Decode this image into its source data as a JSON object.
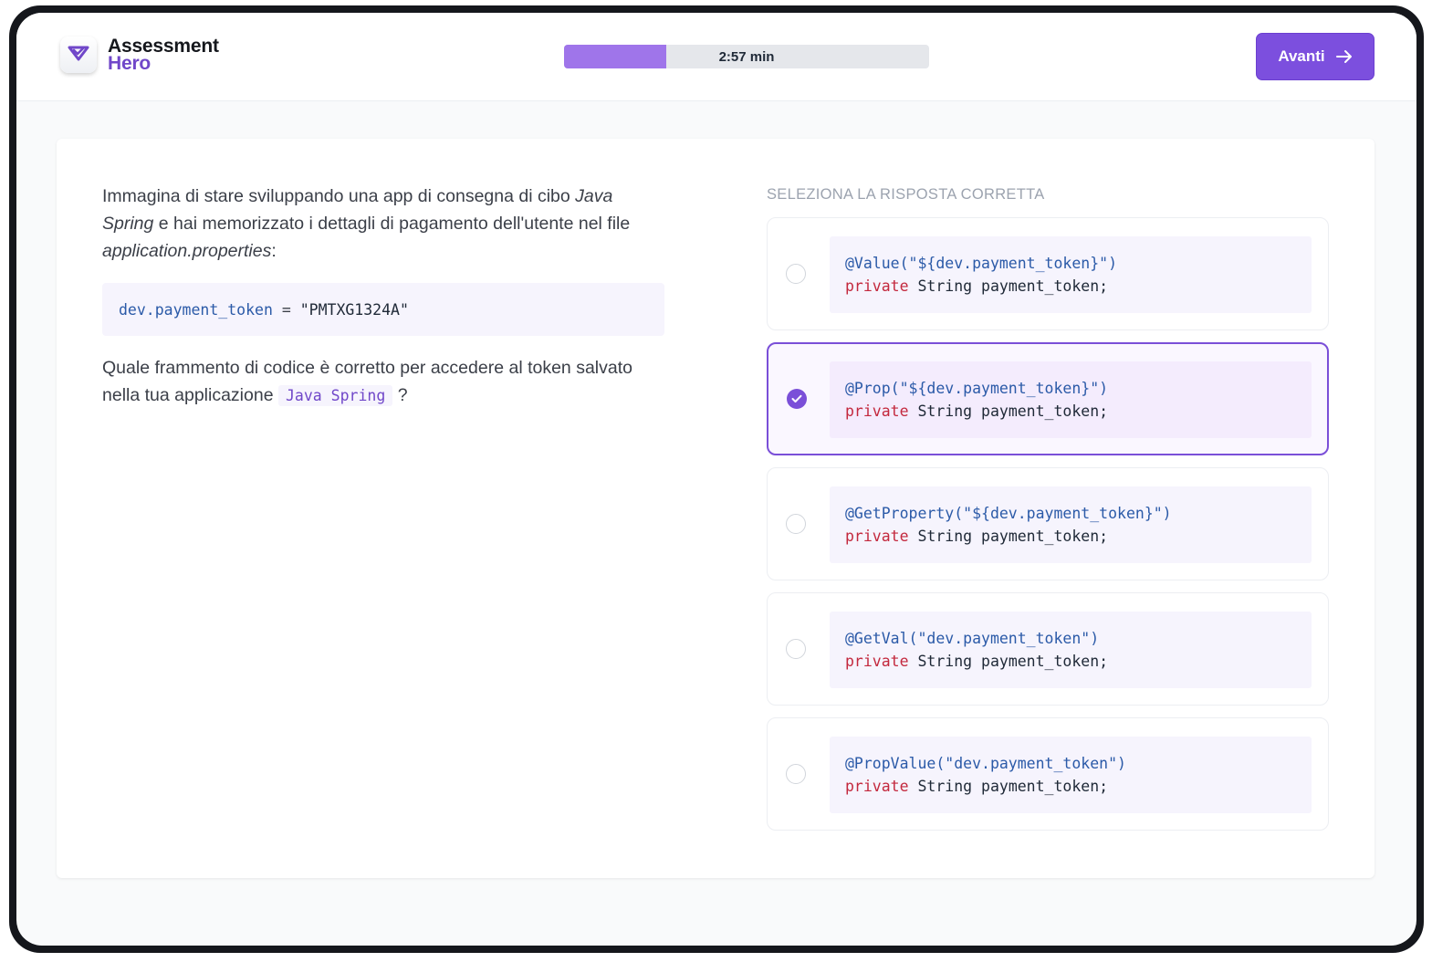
{
  "header": {
    "logo_line1": "Assessment",
    "logo_line2": "Hero",
    "timer": "2:57 min",
    "progress_fraction": 0.28,
    "next_label": "Avanti"
  },
  "question": {
    "intro_part1": "Immagina di stare sviluppando una app di consegna di cibo ",
    "intro_italic1": "Java Spring",
    "intro_part2": " e hai memorizzato i dettagli di pagamento dell'utente nel file ",
    "intro_italic2": "application.properties",
    "intro_part3": ":",
    "code_key": "dev.payment_token",
    "code_eq": " = ",
    "code_value": "\"PMTXG1324A\"",
    "prompt": "Quale frammento di codice è corretto per accedere al token salvato nella tua applicazione",
    "inline_code": "Java Spring",
    "prompt_end": "?"
  },
  "answers": {
    "title": "SELEZIONA LA RISPOSTA CORRETTA",
    "selected_index": 1,
    "options": [
      {
        "annotation": "@Value(\"${dev.payment_token}\")",
        "keyword": "private",
        "rest": " String payment_token;"
      },
      {
        "annotation": "@Prop(\"${dev.payment_token}\")",
        "keyword": "private",
        "rest": " String payment_token;"
      },
      {
        "annotation": "@GetProperty(\"${dev.payment_token}\")",
        "keyword": "private",
        "rest": " String payment_token;"
      },
      {
        "annotation": "@GetVal(\"dev.payment_token\")",
        "keyword": "private",
        "rest": " String payment_token;"
      },
      {
        "annotation": "@PropValue(\"dev.payment_token\")",
        "keyword": "private",
        "rest": " String payment_token;"
      }
    ]
  },
  "colors": {
    "accent": "#7c4fde",
    "progress_fill": "#9f75ea",
    "annotation": "#2b5aa8",
    "keyword": "#c3283d"
  },
  "icons": {
    "logo": "check-chevron-icon",
    "next": "arrow-right-icon",
    "selected": "checkmark-icon"
  }
}
